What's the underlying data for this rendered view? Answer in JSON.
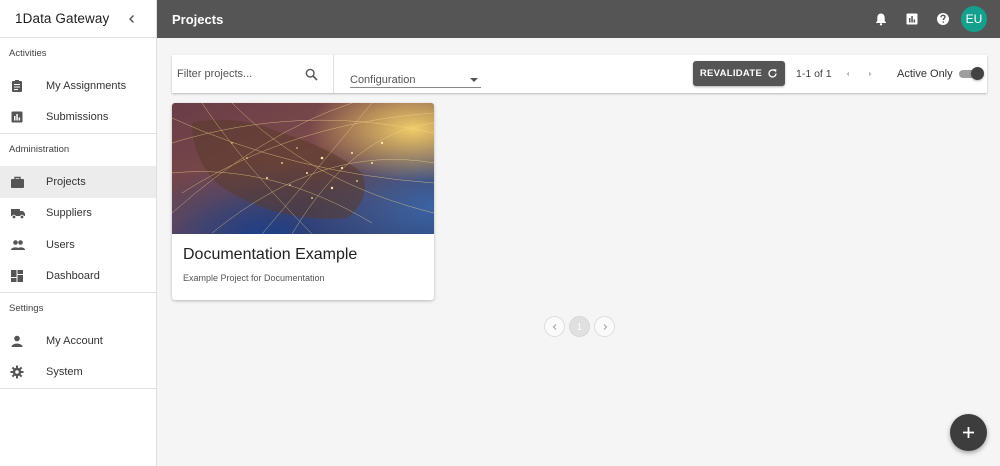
{
  "app": {
    "title": "1Data Gateway"
  },
  "sidebar": {
    "sections": [
      {
        "title": "Activities",
        "items": [
          {
            "label": "My Assignments",
            "icon": "assignment-icon"
          },
          {
            "label": "Submissions",
            "icon": "bar-chart-icon"
          }
        ]
      },
      {
        "title": "Administration",
        "items": [
          {
            "label": "Projects",
            "icon": "briefcase-icon",
            "active": true
          },
          {
            "label": "Suppliers",
            "icon": "truck-icon"
          },
          {
            "label": "Users",
            "icon": "people-icon"
          },
          {
            "label": "Dashboard",
            "icon": "dashboard-icon"
          }
        ]
      },
      {
        "title": "Settings",
        "items": [
          {
            "label": "My Account",
            "icon": "person-icon"
          },
          {
            "label": "System",
            "icon": "gear-icon"
          }
        ]
      }
    ]
  },
  "header": {
    "page_title": "Projects",
    "avatar_initials": "EU",
    "avatar_color": "#13a08d",
    "bar_color": "#555555"
  },
  "toolbar": {
    "filter_placeholder": "Filter projects...",
    "filter_value": "",
    "config_label": "Configuration",
    "revalidate_label": "REVALIDATE",
    "page_range": "1-1 of 1",
    "active_only_label": "Active Only",
    "active_only_on": true
  },
  "projects": [
    {
      "title": "Documentation Example",
      "description": "Example Project for Documentation",
      "image": "night-earth-network-image"
    }
  ],
  "pager": {
    "current": "1"
  }
}
